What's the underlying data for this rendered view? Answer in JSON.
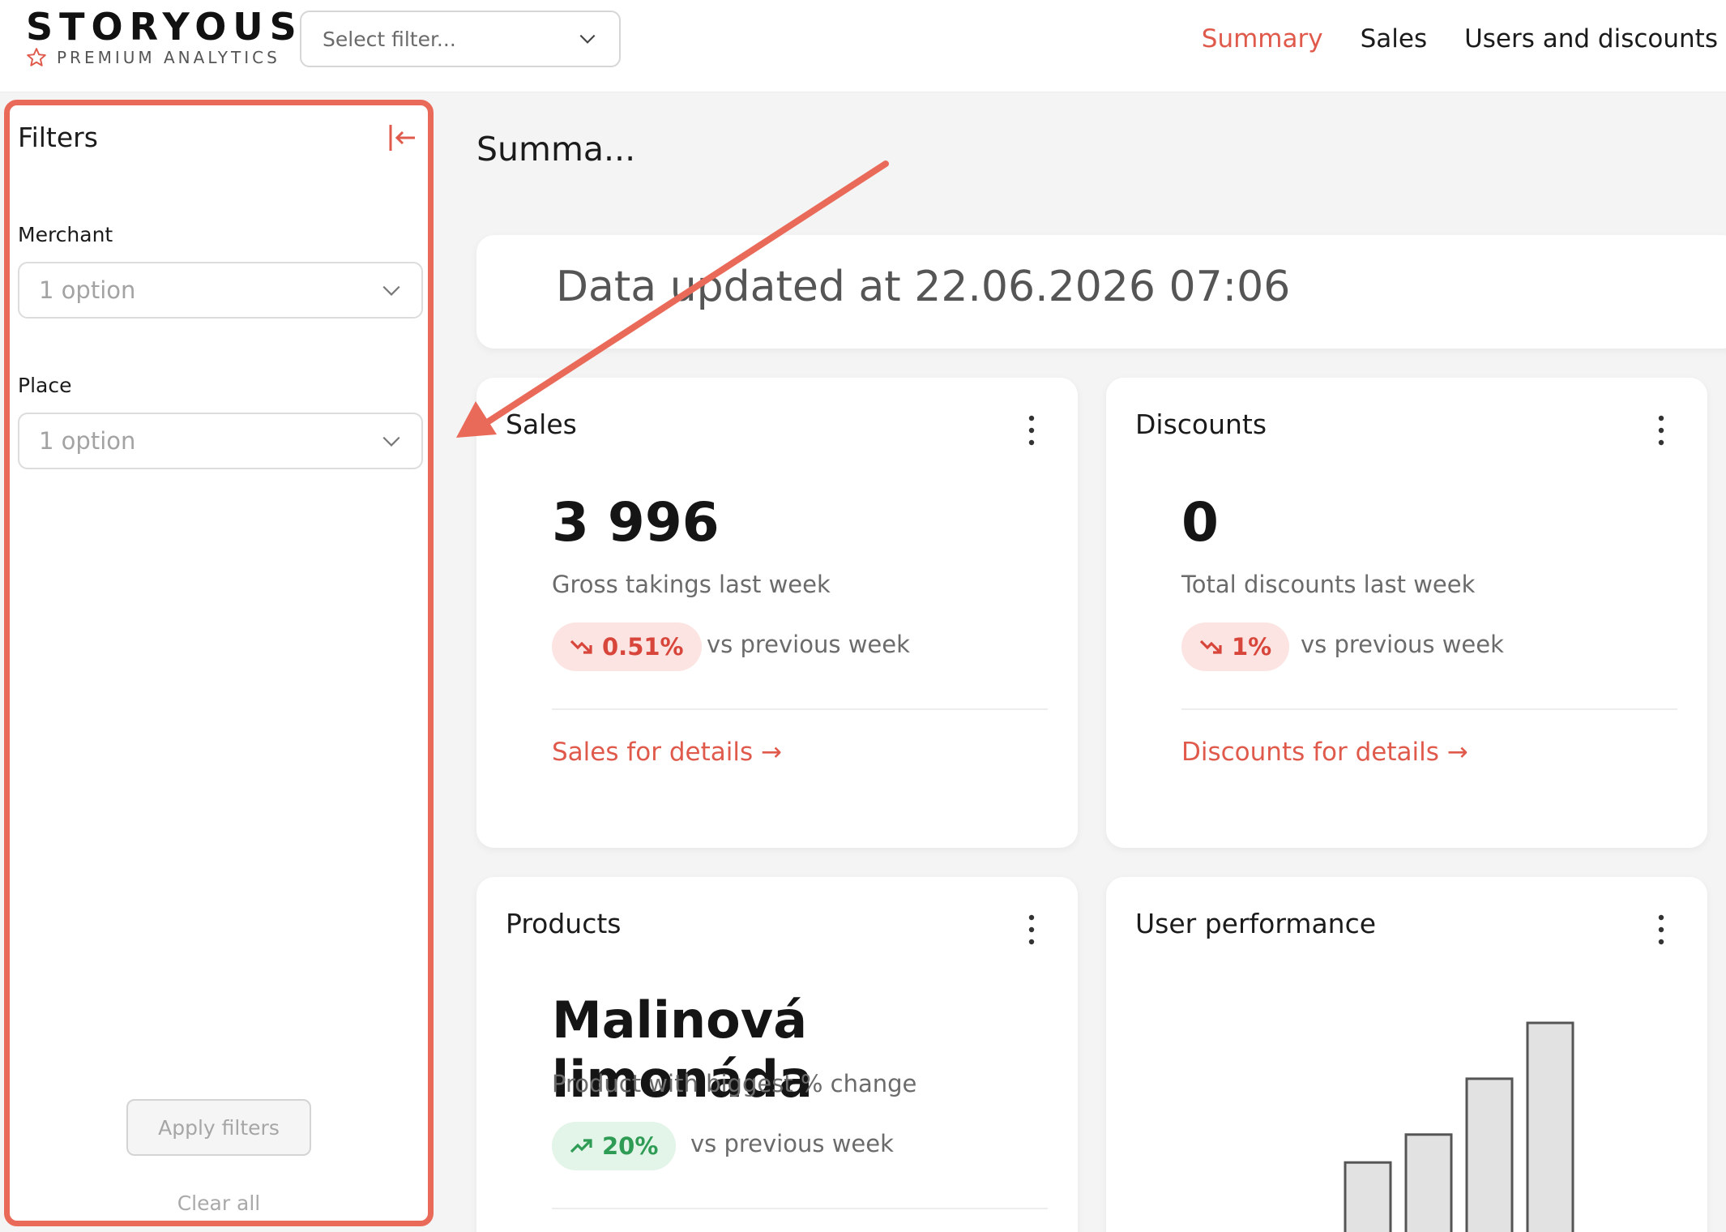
{
  "header": {
    "logo": "STORYOUS",
    "logo_subtitle": "PREMIUM ANALYTICS",
    "filter_placeholder": "Select filter...",
    "nav": [
      {
        "label": "Summary",
        "active": true
      },
      {
        "label": "Sales",
        "active": false
      },
      {
        "label": "Users and discounts",
        "active": false
      }
    ]
  },
  "sidebar": {
    "title": "Filters",
    "merchant_label": "Merchant",
    "merchant_value": "1 option",
    "place_label": "Place",
    "place_value": "1 option",
    "apply_label": "Apply filters",
    "clear_label": "Clear all"
  },
  "main": {
    "title": "Summa...",
    "updated_text": "Data updated at 22.06.2026 07:06",
    "cards": [
      {
        "title": "Sales",
        "value": "3 996",
        "subtitle": "Gross takings last week",
        "change": "0.51%",
        "trend": "down",
        "compare": "vs previous week",
        "link": "Sales for details →"
      },
      {
        "title": "Discounts",
        "value": "0",
        "subtitle": "Total discounts last week",
        "change": "1%",
        "trend": "down",
        "compare": "vs previous week",
        "link": "Discounts for details →"
      },
      {
        "title": "Products",
        "value": "Malinová limonáda",
        "subtitle": "Product with biggest % change",
        "change": "20%",
        "trend": "up",
        "compare": "vs previous week"
      },
      {
        "title": "User performance"
      }
    ]
  },
  "colors": {
    "accent": "#e05a4c",
    "highlight_border": "#ea6a5a",
    "negative": "#d8463b",
    "positive": "#2f9c55"
  },
  "chart_data": {
    "type": "bar",
    "values": [
      4,
      5,
      7,
      9
    ],
    "ylim": [
      0,
      9
    ]
  }
}
